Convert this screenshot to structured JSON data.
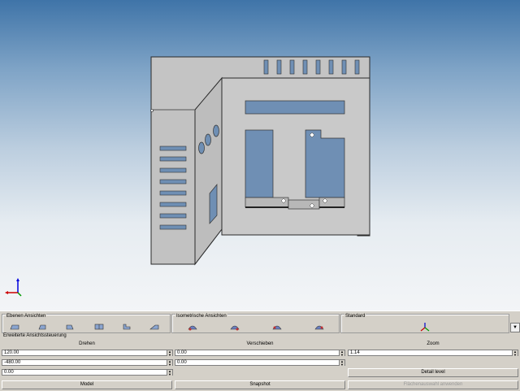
{
  "panel": {
    "ebenen_label": "Ebenen Ansichten",
    "iso_label": "Isometrische Ansichten",
    "standard_label": "Standard",
    "extended_label": "Erweiterte Ansichtssteuerung",
    "drehen_label": "Drehen",
    "verschieben_label": "Verschieben",
    "zoom_label": "Zoom",
    "rotate_x": "120.00",
    "rotate_y": "-480.00",
    "rotate_z": "0.00",
    "move_x": "0.00",
    "move_y": "0.00",
    "zoom_value": "1.14",
    "detail_button": "Detail level",
    "model_button": "Model",
    "snapshot_button": "Snapshot",
    "apply_button": "Flächenauswahl anwenden"
  },
  "icons": {
    "ebenen": [
      "front-view-icon",
      "back-view-icon",
      "left-view-icon",
      "top-view-icon",
      "right-view-icon",
      "bottom-view-icon"
    ],
    "iso": [
      "iso-view-1-icon",
      "iso-view-2-icon",
      "iso-view-3-icon",
      "iso-view-4-icon"
    ],
    "standard": "axis-triad-icon"
  },
  "colors": {
    "sky_top": "#3f74a8",
    "sky_bottom": "#f3f5f7",
    "model_face": "#c6c6c6",
    "panel_bg": "#d4d0c8"
  }
}
